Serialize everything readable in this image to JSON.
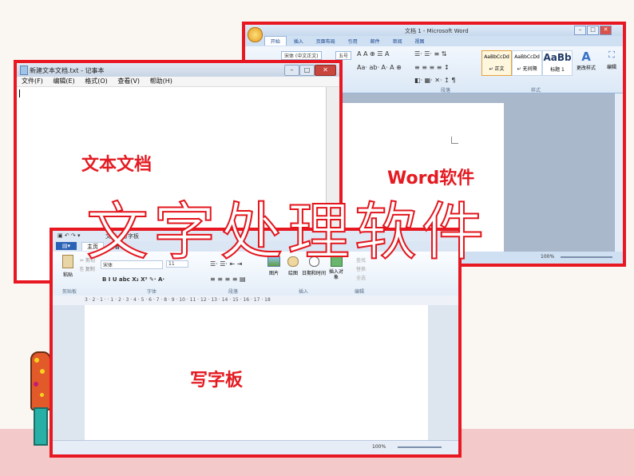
{
  "word": {
    "title": "文档 1 - Microsoft Word",
    "tabs": [
      "开始",
      "插入",
      "页面布局",
      "引用",
      "邮件",
      "审阅",
      "视图"
    ],
    "font_name": "宋体 (中文正文)",
    "font_size": "五号",
    "styles": [
      "AaBbCcDd",
      "AaBbCcDd",
      "AaBb"
    ],
    "style_names": [
      "↵ 正文",
      "↵ 无间隔",
      "标题 1"
    ],
    "change_styles": "更改样式",
    "edit": "编辑",
    "group_paragraph": "段落",
    "group_styles": "样式",
    "zoom": "100%"
  },
  "notepad": {
    "title": "新建文本文档.txt - 记事本",
    "menu": [
      "文件(F)",
      "编辑(E)",
      "格式(O)",
      "查看(V)",
      "帮助(H)"
    ]
  },
  "wordpad": {
    "title": "文档 - 写字板",
    "tabs": [
      "主页",
      "查看"
    ],
    "paste": "粘贴",
    "cut": "剪切",
    "copy": "复制",
    "font_size": "11",
    "font_name": "宋体",
    "picture": "图片",
    "paint": "绘图",
    "datetime": "日期和时间",
    "insert_object": "插入对象",
    "find": "查找",
    "replace": "替换",
    "select_all": "全选",
    "groups": [
      "剪贴板",
      "字体",
      "段落",
      "插入",
      "编辑"
    ],
    "ruler": "3 · 2 · 1 · · 1 · 2 · 3 · 4 · 5 · 6 · 7 · 8 · 9 · 10 · 11 · 12 · 13 · 14 · 15 · 16 · 17 · 18",
    "zoom": "100%"
  },
  "labels": {
    "notepad_label": "文本文档",
    "word_label": "Word软件",
    "wordpad_label": "写字板",
    "main_title": "文字处理软件"
  },
  "colors": {
    "frame": "#e81822",
    "label": "#e41b22",
    "band": "#f4c9c9"
  }
}
